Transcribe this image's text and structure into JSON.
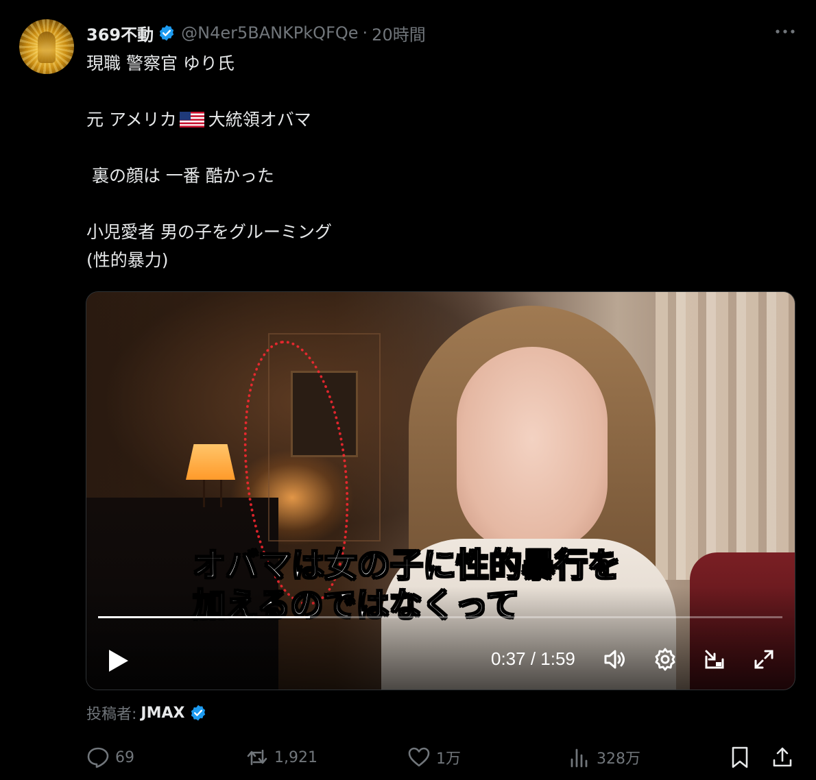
{
  "post": {
    "display_name": "369不動",
    "handle": "@N4er5BANKPkQFQe",
    "separator": "·",
    "time_ago": "20時間",
    "text_line1": "現職 警察官 ゆり氏",
    "text_line2_before_flag": "元 アメリカ",
    "text_line2_after_flag": "大統領オバマ",
    "text_line3": " 裏の顔は 一番 酷かった",
    "text_line4": "小児愛者 男の子をグルーミング",
    "text_line5": "(性的暴力)"
  },
  "video": {
    "caption_line1": "オバマは女の子に性的暴行を",
    "caption_line2": "加えるのではなくって",
    "time_display": "0:37 / 1:59",
    "progress_fraction": 0.31
  },
  "attribution": {
    "label": "投稿者:",
    "author": "JMAX"
  },
  "actions": {
    "reply_count": "69",
    "repost_count": "1,921",
    "like_count": "1万",
    "views_count": "328万"
  },
  "colors": {
    "background": "#000000",
    "text": "#e7e9ea",
    "muted": "#71767b",
    "verified": "#1d9bf0"
  },
  "icons": [
    "verified-badge-icon",
    "more-icon",
    "us-flag-icon",
    "play-icon",
    "volume-icon",
    "settings-icon",
    "pip-icon",
    "fullscreen-icon",
    "reply-icon",
    "repost-icon",
    "like-icon",
    "views-icon",
    "bookmark-icon",
    "share-icon"
  ]
}
